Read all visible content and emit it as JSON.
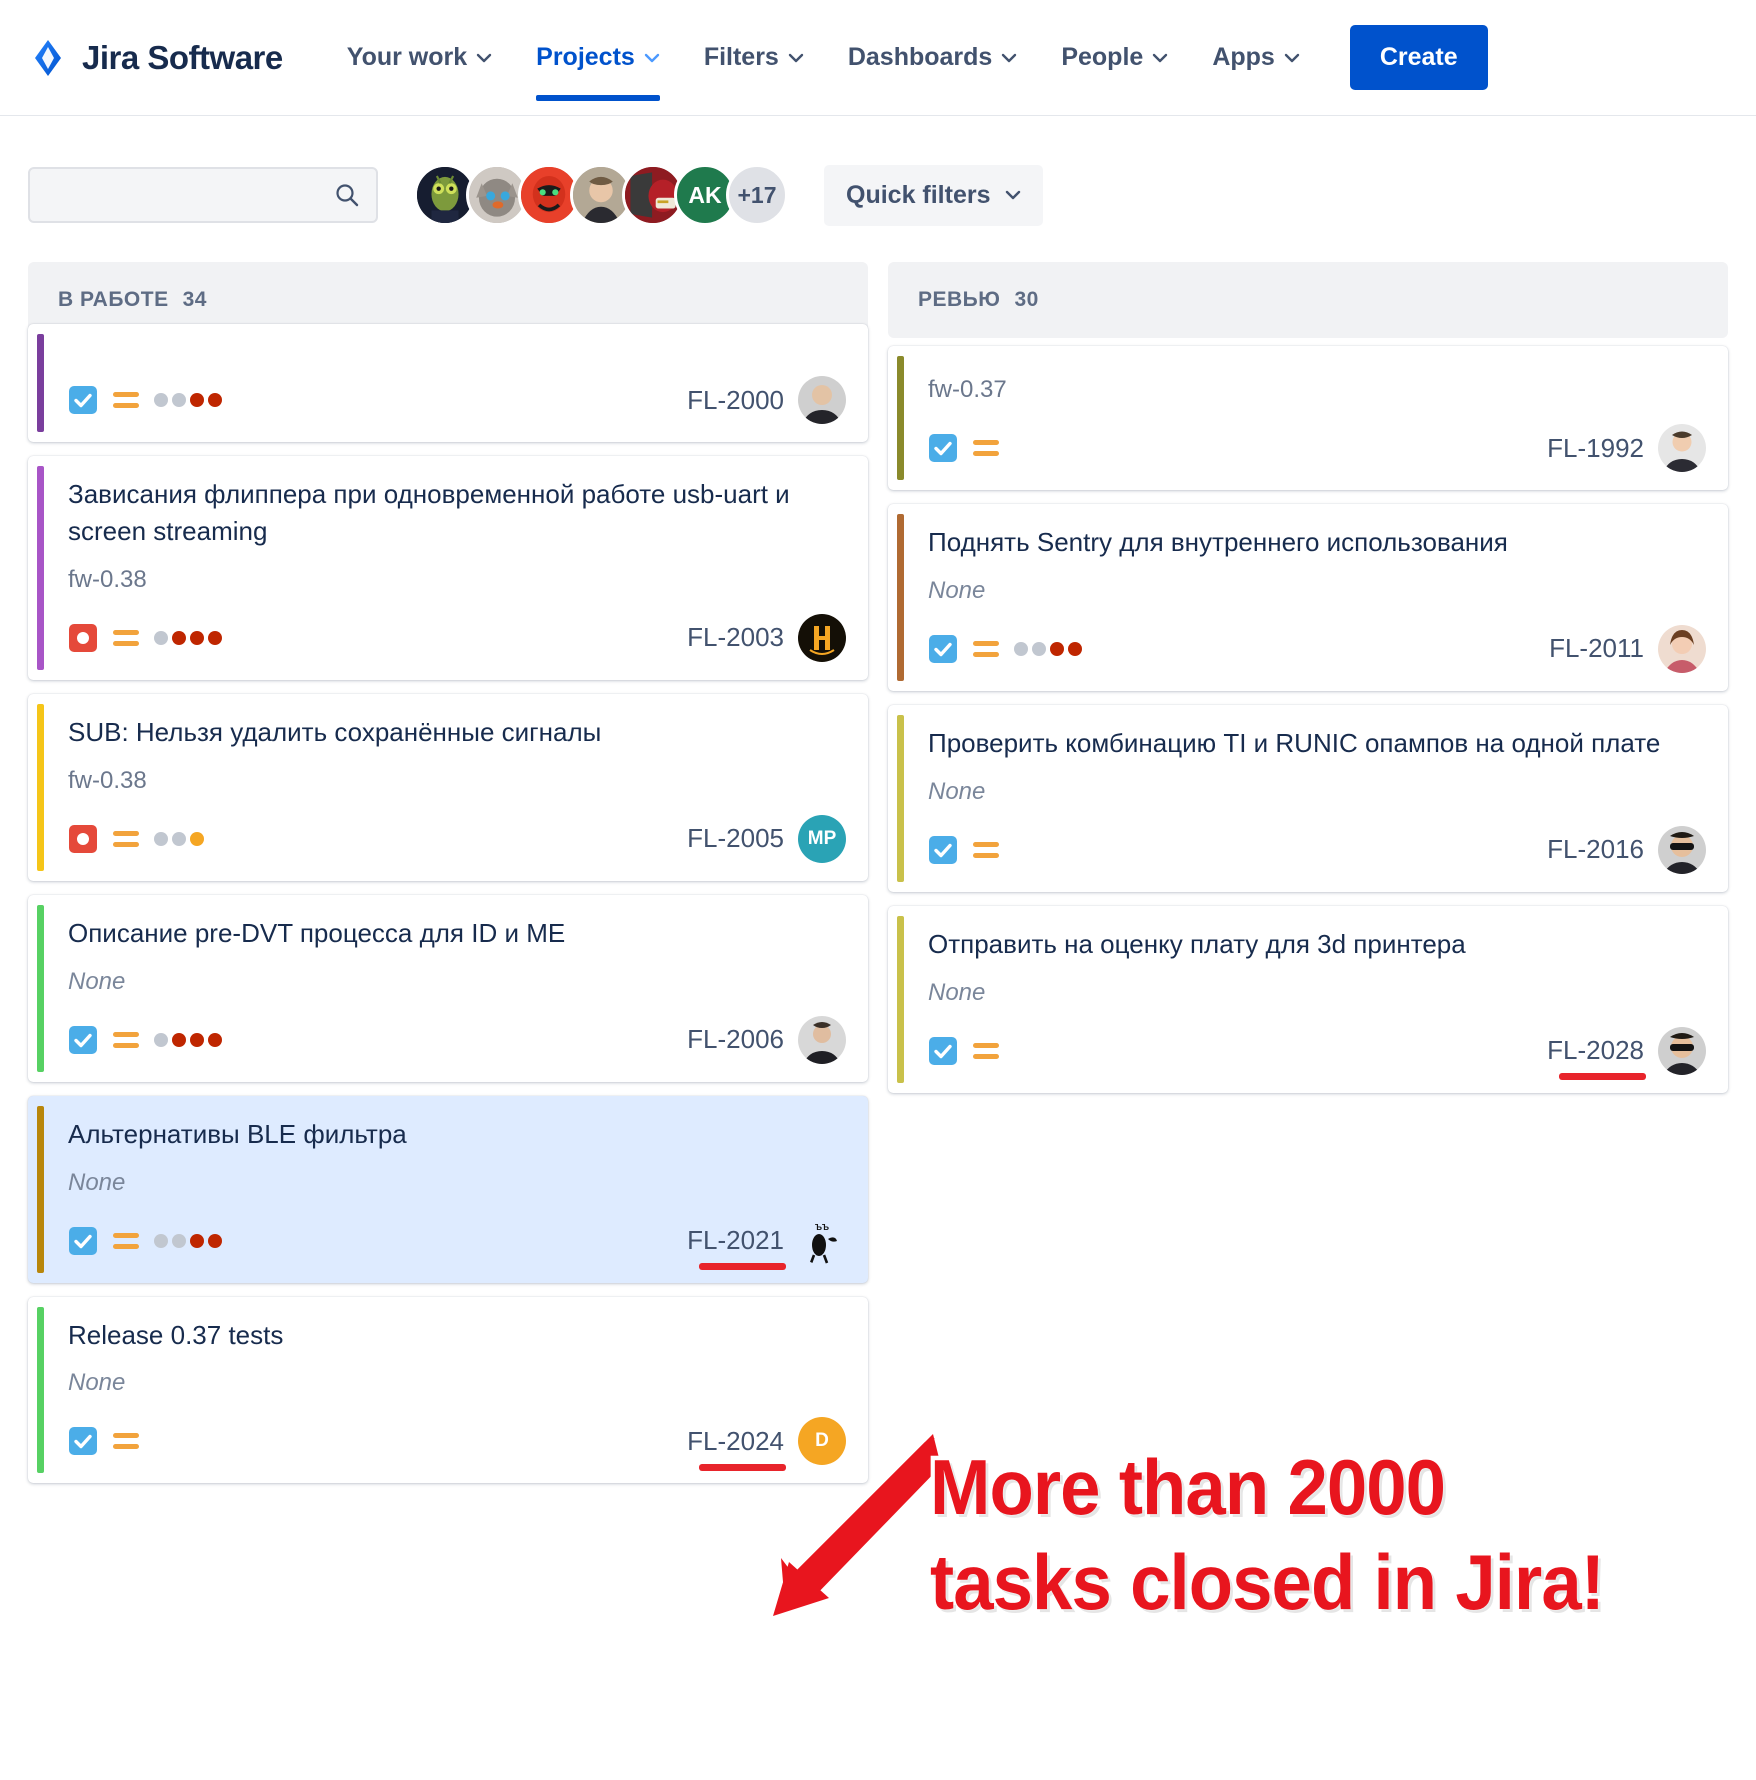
{
  "app": {
    "brand": "Jira Software",
    "logo_icon": "jira-diamond-icon"
  },
  "nav": {
    "items": [
      {
        "label": "Your work",
        "has_caret": true,
        "active": false
      },
      {
        "label": "Projects",
        "has_caret": true,
        "active": true
      },
      {
        "label": "Filters",
        "has_caret": true,
        "active": false
      },
      {
        "label": "Dashboards",
        "has_caret": true,
        "active": false
      },
      {
        "label": "People",
        "has_caret": true,
        "active": false
      },
      {
        "label": "Apps",
        "has_caret": true,
        "active": false
      }
    ],
    "create_label": "Create",
    "create_color": "#0052CC"
  },
  "toolbar": {
    "search_placeholder": "",
    "search_value": "",
    "search_icon": "search-icon",
    "avatars": [
      {
        "kind": "image",
        "name": "mantis-avatar",
        "bg": "#1b2236"
      },
      {
        "kind": "image",
        "name": "cat-avatar",
        "bg": "#b6b0ab"
      },
      {
        "kind": "image",
        "name": "red-mask-avatar",
        "bg": "#e03a24"
      },
      {
        "kind": "image",
        "name": "person-photo-avatar",
        "bg": "#a99d8c"
      },
      {
        "kind": "image",
        "name": "ranger-avatar",
        "bg": "#8e1b21"
      },
      {
        "kind": "initials",
        "name": "ak-avatar",
        "initials": "AK",
        "bg": "#1f7a4d"
      },
      {
        "kind": "more",
        "name": "avatar-overflow-badge",
        "label": "+17",
        "bg": "#DFE1E6"
      }
    ],
    "quick_filters_label": "Quick filters",
    "quick_filters_caret": "chevron-down-icon"
  },
  "columns": [
    {
      "id": "in-progress",
      "title": "В РАБОТЕ",
      "count": "34",
      "cards": [
        {
          "clipped": true,
          "stripe": "#7A3E9D",
          "title": "",
          "meta": "",
          "type_icon": "task-icon",
          "type_color": "#4BADE8",
          "priority_icon": "priority-medium-icon",
          "dots": [
            "#C1C7D0",
            "#C1C7D0",
            "#BF2600",
            "#BF2600"
          ],
          "key": "FL-2000",
          "key_underlined": false,
          "assignee": {
            "kind": "image",
            "name": "assignee-photo-avatar",
            "bg": "#3c3c3c"
          }
        },
        {
          "clipped": false,
          "stripe": "#A855C7",
          "title": "Зависания флиппера при одновременной работе usb-uart и screen streaming",
          "meta": "fw-0.38",
          "meta_none": false,
          "type_icon": "bug-icon",
          "type_color": "#E5493A",
          "priority_icon": "priority-medium-icon",
          "dots": [
            "#C1C7D0",
            "#BF2600",
            "#BF2600",
            "#BF2600"
          ],
          "key": "FL-2003",
          "key_underlined": false,
          "assignee": {
            "kind": "image",
            "name": "assignee-logo-avatar",
            "bg": "#1a1208"
          }
        },
        {
          "clipped": false,
          "stripe": "#F5C518",
          "title": "SUB: Нельзя удалить сохранённые сигналы",
          "meta": "fw-0.38",
          "meta_none": false,
          "type_icon": "bug-icon",
          "type_color": "#E5493A",
          "priority_icon": "priority-medium-icon",
          "dots": [
            "#C1C7D0",
            "#C1C7D0",
            "#F5A623"
          ],
          "key": "FL-2005",
          "key_underlined": false,
          "assignee": {
            "kind": "initials",
            "name": "assignee-mp-avatar",
            "initials": "MP",
            "bg": "#2AA3B5"
          }
        },
        {
          "clipped": false,
          "stripe": "#57D163",
          "title": "Описание pre-DVT процесса для ID и ME",
          "meta": "None",
          "meta_none": true,
          "type_icon": "task-icon",
          "type_color": "#4BADE8",
          "priority_icon": "priority-medium-icon",
          "dots": [
            "#C1C7D0",
            "#BF2600",
            "#BF2600",
            "#BF2600"
          ],
          "key": "FL-2006",
          "key_underlined": false,
          "assignee": {
            "kind": "image",
            "name": "assignee-dark-photo-avatar",
            "bg": "#2b2b2b"
          }
        },
        {
          "clipped": false,
          "selected": true,
          "stripe": "#B8860B",
          "title": "Альтернативы BLE фильтра",
          "meta": "None",
          "meta_none": true,
          "type_icon": "task-icon",
          "type_color": "#4BADE8",
          "priority_icon": "priority-medium-icon",
          "dots": [
            "#C1C7D0",
            "#C1C7D0",
            "#BF2600",
            "#BF2600"
          ],
          "key": "FL-2021",
          "key_underlined": true,
          "assignee": {
            "kind": "image",
            "name": "assignee-cat-logo-avatar",
            "bg": "#ffffff"
          }
        },
        {
          "clipped": false,
          "stripe": "#57D163",
          "title": "Release 0.37 tests",
          "meta": "None",
          "meta_none": true,
          "type_icon": "task-icon",
          "type_color": "#4BADE8",
          "priority_icon": "priority-medium-icon",
          "dots": [],
          "key": "FL-2024",
          "key_underlined": true,
          "assignee": {
            "kind": "initials",
            "name": "assignee-d-avatar",
            "initials": "D",
            "bg": "#F5A623"
          }
        }
      ]
    },
    {
      "id": "review",
      "title": "РЕВЬЮ",
      "count": "30",
      "cards": [
        {
          "clipped": true,
          "stripe": "#8A8A2B",
          "title": "",
          "meta": "fw-0.37",
          "meta_none": false,
          "type_icon": "task-icon",
          "type_color": "#4BADE8",
          "priority_icon": "priority-medium-icon",
          "dots": [],
          "key": "FL-1992",
          "key_underlined": false,
          "assignee": {
            "kind": "image",
            "name": "assignee-portrait-avatar",
            "bg": "#d9d9d9"
          }
        },
        {
          "clipped": false,
          "stripe": "#B06A32",
          "title": "Поднять Sentry для внутреннего использования",
          "meta": "None",
          "meta_none": true,
          "type_icon": "task-icon",
          "type_color": "#4BADE8",
          "priority_icon": "priority-medium-icon",
          "dots": [
            "#C1C7D0",
            "#C1C7D0",
            "#BF2600",
            "#BF2600"
          ],
          "key": "FL-2011",
          "key_underlined": false,
          "assignee": {
            "kind": "image",
            "name": "assignee-woman-photo-avatar",
            "bg": "#e8c0ac"
          }
        },
        {
          "clipped": false,
          "stripe": "#C9C14A",
          "title": "Проверить комбинацию TI и RUNIC опампов на одной плате",
          "meta": "None",
          "meta_none": true,
          "type_icon": "task-icon",
          "type_color": "#4BADE8",
          "priority_icon": "priority-medium-icon",
          "dots": [],
          "key": "FL-2016",
          "key_underlined": false,
          "assignee": {
            "kind": "image",
            "name": "assignee-sunglasses-avatar",
            "bg": "#3a3a3a"
          }
        },
        {
          "clipped": false,
          "stripe": "#C9C14A",
          "title": "Отправить на оценку плату для 3d принтера",
          "meta": "None",
          "meta_none": true,
          "type_icon": "task-icon",
          "type_color": "#4BADE8",
          "priority_icon": "priority-medium-icon",
          "dots": [],
          "key": "FL-2028",
          "key_underlined": true,
          "assignee": {
            "kind": "image",
            "name": "assignee-sunglasses-avatar",
            "bg": "#3a3a3a"
          }
        }
      ]
    }
  ],
  "annotation": {
    "line1": "More than 2000",
    "line2": "tasks closed in Jira!",
    "color": "#E8151E",
    "arrow_icon": "red-arrow-icon"
  }
}
